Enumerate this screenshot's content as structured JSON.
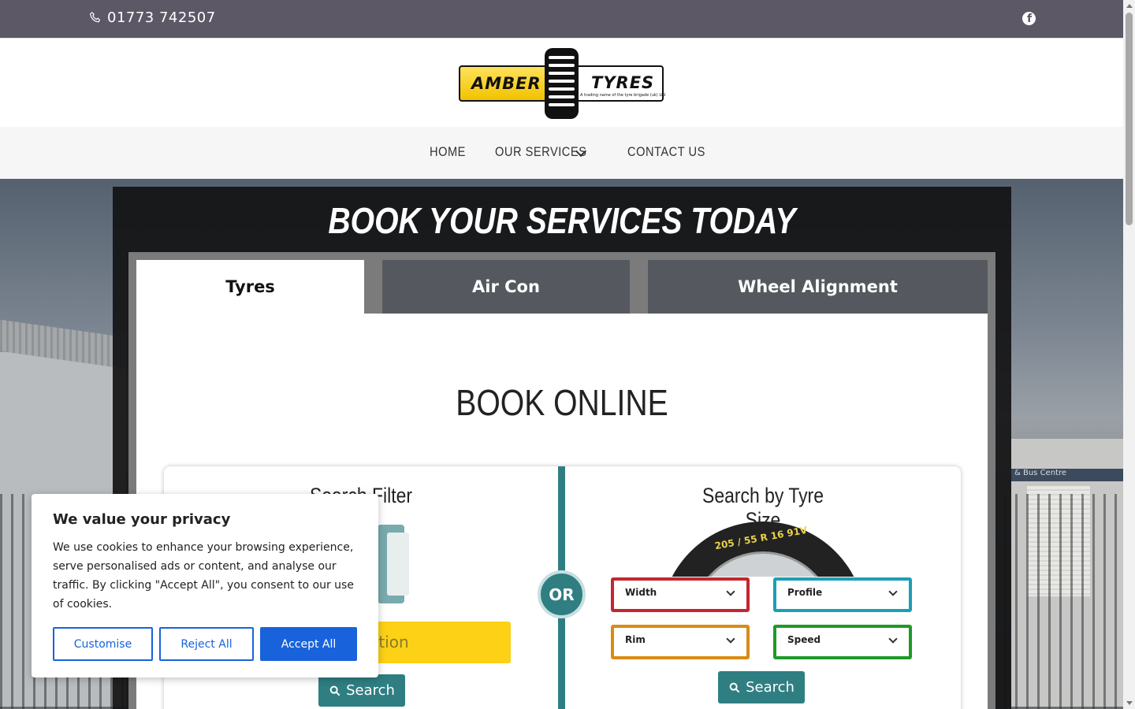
{
  "topbar": {
    "phone": "01773 742507",
    "social_icon": "facebook-icon"
  },
  "logo": {
    "left_text": "AMBER",
    "right_text": "TYRES",
    "subtext": "A trading name of the tyre brigade (uk) Ltd"
  },
  "nav": {
    "items": [
      {
        "label": "HOME"
      },
      {
        "label": "OUR SERVICES"
      },
      {
        "label": "CONTACT US"
      }
    ]
  },
  "booking": {
    "title": "BOOK YOUR SERVICES TODAY",
    "tabs": [
      {
        "label": "Tyres"
      },
      {
        "label": "Air Con"
      },
      {
        "label": "Wheel Alignment"
      }
    ],
    "heading": "BOOK ONLINE",
    "left": {
      "title": "Search Filter",
      "reg_input_visible": "tration",
      "search_label": "Search"
    },
    "or_label": "OR",
    "right": {
      "title": "Search by Tyre Size",
      "tyre_text": "205 / 55 R 16 91V",
      "selects": {
        "width": "Width",
        "profile": "Profile",
        "rim": "Rim",
        "speed": "Speed"
      },
      "search_label": "Search"
    }
  },
  "cookie": {
    "title": "We value your privacy",
    "body": "We use cookies to enhance your browsing experience, serve personalised ads or content, and analyse our traffic. By clicking \"Accept All\", you consent to our use of cookies.",
    "customise": "Customise",
    "reject": "Reject All",
    "accept": "Accept All"
  },
  "building_sign": "& Bus Centre",
  "colors": {
    "topbar": "#5d5866",
    "teal": "#2f7e82",
    "yellow": "#fcd116",
    "cookie_blue": "#1863dc"
  }
}
